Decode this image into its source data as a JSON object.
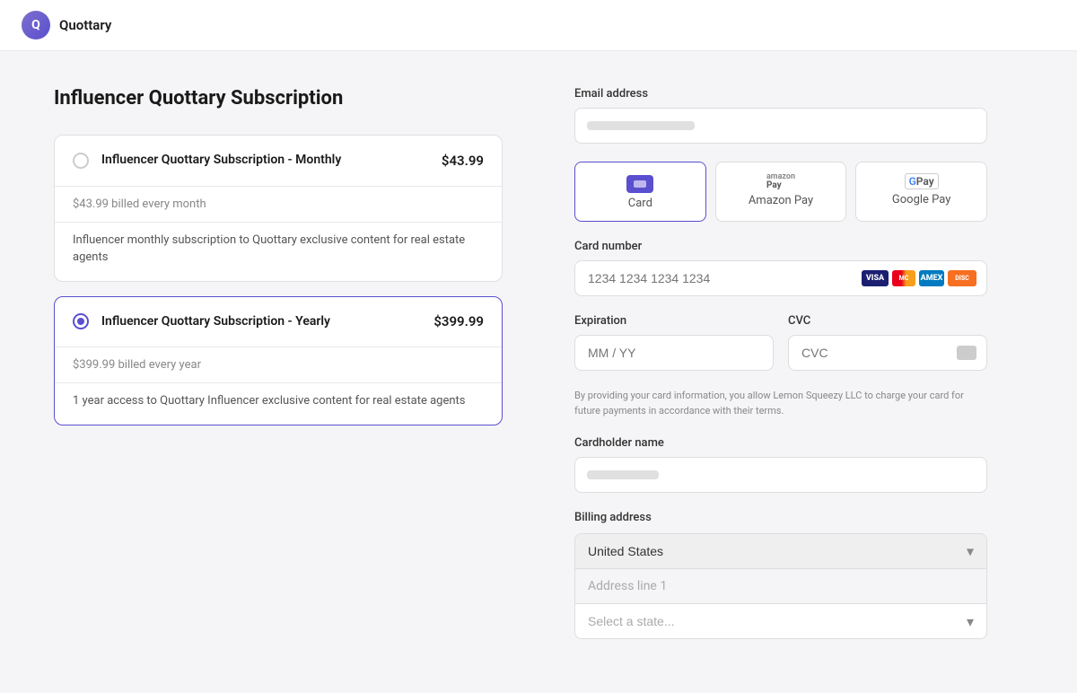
{
  "header": {
    "logo_letter": "Q",
    "brand_name": "Quottary"
  },
  "page": {
    "title": "Influencer Quottary Subscription"
  },
  "plans": [
    {
      "id": "monthly",
      "name": "Influencer Quottary Subscription - Monthly",
      "price": "$43.99",
      "billing": "$43.99 billed every month",
      "description": "Influencer monthly subscription to Quottary exclusive content for real estate agents",
      "selected": false
    },
    {
      "id": "yearly",
      "name": "Influencer Quottary Subscription - Yearly",
      "price": "$399.99",
      "billing": "$399.99 billed every year",
      "description": "1 year access to Quottary Influencer exclusive content for real estate agents",
      "selected": true
    }
  ],
  "payment_form": {
    "email_label": "Email address",
    "email_placeholder": "",
    "payment_methods": [
      {
        "id": "card",
        "label": "Card",
        "active": true
      },
      {
        "id": "amazon_pay",
        "label": "Amazon Pay",
        "active": false
      },
      {
        "id": "google_pay",
        "label": "Google Pay",
        "active": false
      }
    ],
    "card_number_label": "Card number",
    "card_number_placeholder": "1234 1234 1234 1234",
    "expiration_label": "Expiration",
    "expiration_placeholder": "MM / YY",
    "cvc_label": "CVC",
    "cvc_placeholder": "CVC",
    "disclaimer": "By providing your card information, you allow Lemon Squeezy LLC to charge your card for future payments in accordance with their terms.",
    "cardholder_label": "Cardholder name",
    "cardholder_placeholder": "",
    "billing_label": "Billing address",
    "country_default": "United States",
    "address_placeholder": "Address line 1",
    "state_placeholder": "Select a state..."
  }
}
